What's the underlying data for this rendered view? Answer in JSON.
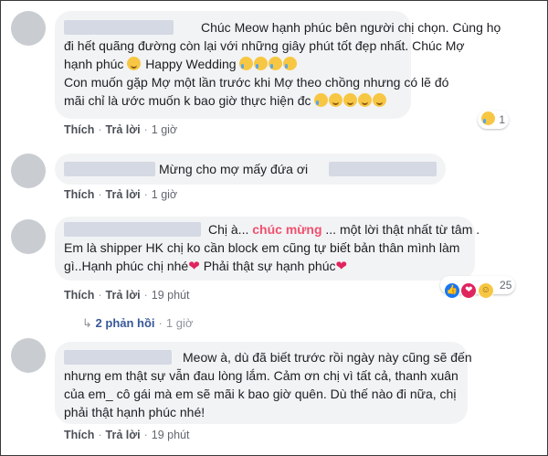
{
  "comments": [
    {
      "line1_text": "Chúc Meow hạnh phúc bên người chị chọn. Cùng họ",
      "line2_text": "đi hết quãng đường còn lại với những giây phút tốt đẹp nhất. Chúc Mợ",
      "line3_text": "hạnh phúc",
      "line3_text2": "Happy Wedding",
      "line4_text": "Con muốn gặp Mợ một lần trước khi Mợ theo chồng nhưng có lẽ đó",
      "line5_text": "mãi chỉ là ước muốn k bao giờ thực hiện đc",
      "like_label": "Thích",
      "reply_label": "Trả lời",
      "time": "1 giờ",
      "reaction_count": "1"
    },
    {
      "text": "Mừng cho mợ mấy đứa ơi",
      "like_label": "Thích",
      "reply_label": "Trả lời",
      "time": "1 giờ"
    },
    {
      "line1_pre": "Chị à...",
      "line1_highlight": "chúc mừng",
      "line1_post": "... một lời thật nhất từ tâm .",
      "line2_text": "Em là shipper HK chị ko cần block em cũng tự biết bản thân mình làm",
      "line3_text": "gì..Hạnh phúc chị nhé",
      "line3_text2": "Phải thật sự hạnh phúc",
      "like_label": "Thích",
      "reply_label": "Trả lời",
      "time": "19 phút",
      "reaction_count": "25",
      "replies_label": "2 phản hồi",
      "replies_time": "1 giờ"
    },
    {
      "line1_text": "Meow à, dù đã biết trước rồi ngày này cũng sẽ đến",
      "line2_text": "nhưng em thật sự vẫn đau lòng lắm. Cảm ơn chị vì tất cả, thanh xuân",
      "line3_text": "của em_ cô gái mà em sẽ mãi k bao giờ quên. Dù thế nào đi nữa, chị",
      "line4_text": "phải thật hạnh phúc nhé!",
      "like_label": "Thích",
      "reply_label": "Trả lời",
      "time": "19 phút"
    }
  ],
  "colors": {
    "bubble": "#f2f3f5",
    "link": "#385898",
    "highlight": "#f0506e",
    "heart": "#e0245e",
    "like": "#1877f2"
  },
  "icons": {
    "emoji_smile": "smile-icon",
    "emoji_cry": "crying-face-icon",
    "heart": "heart-icon",
    "reply_arrow": "reply-arrow-icon"
  }
}
